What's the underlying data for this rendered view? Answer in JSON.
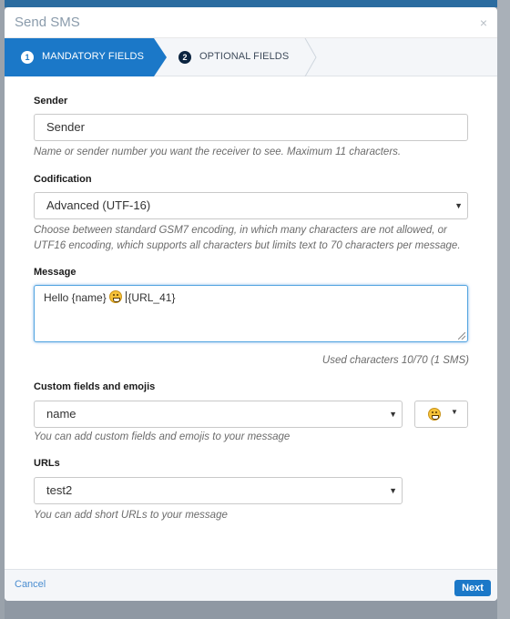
{
  "modal": {
    "title": "Send SMS",
    "close_glyph": "×"
  },
  "steps": [
    {
      "number": "1",
      "label": "MANDATORY FIELDS",
      "active": true
    },
    {
      "number": "2",
      "label": "OPTIONAL FIELDS",
      "active": false
    }
  ],
  "sender": {
    "label": "Sender",
    "value": "Sender",
    "help": "Name or sender number you want the receiver to see. Maximum 11 characters."
  },
  "codification": {
    "label": "Codification",
    "selected": "Advanced (UTF-16)",
    "help": "Choose between standard GSM7 encoding, in which many characters are not allowed, or UTF16 encoding, which supports all characters but limits text to 70 characters per message."
  },
  "message": {
    "label": "Message",
    "text_before": "Hello {name}",
    "emoji": "grinning-face",
    "text_after": "{URL_41}",
    "counter": "Used characters 10/70 (1 SMS)"
  },
  "custom_fields": {
    "label": "Custom fields and emojis",
    "selected": "name",
    "help": "You can add custom fields and emojis to your message",
    "emoji_picker_icon": "grinning-face"
  },
  "urls": {
    "label": "URLs",
    "selected": "test2",
    "help": "You can add short URLs to your message"
  },
  "footer": {
    "cancel_label": "Cancel",
    "next_label": "Next"
  },
  "colors": {
    "primary": "#1b78c8",
    "step2_badge": "#0b2440",
    "focus_border": "#52a4e0"
  }
}
